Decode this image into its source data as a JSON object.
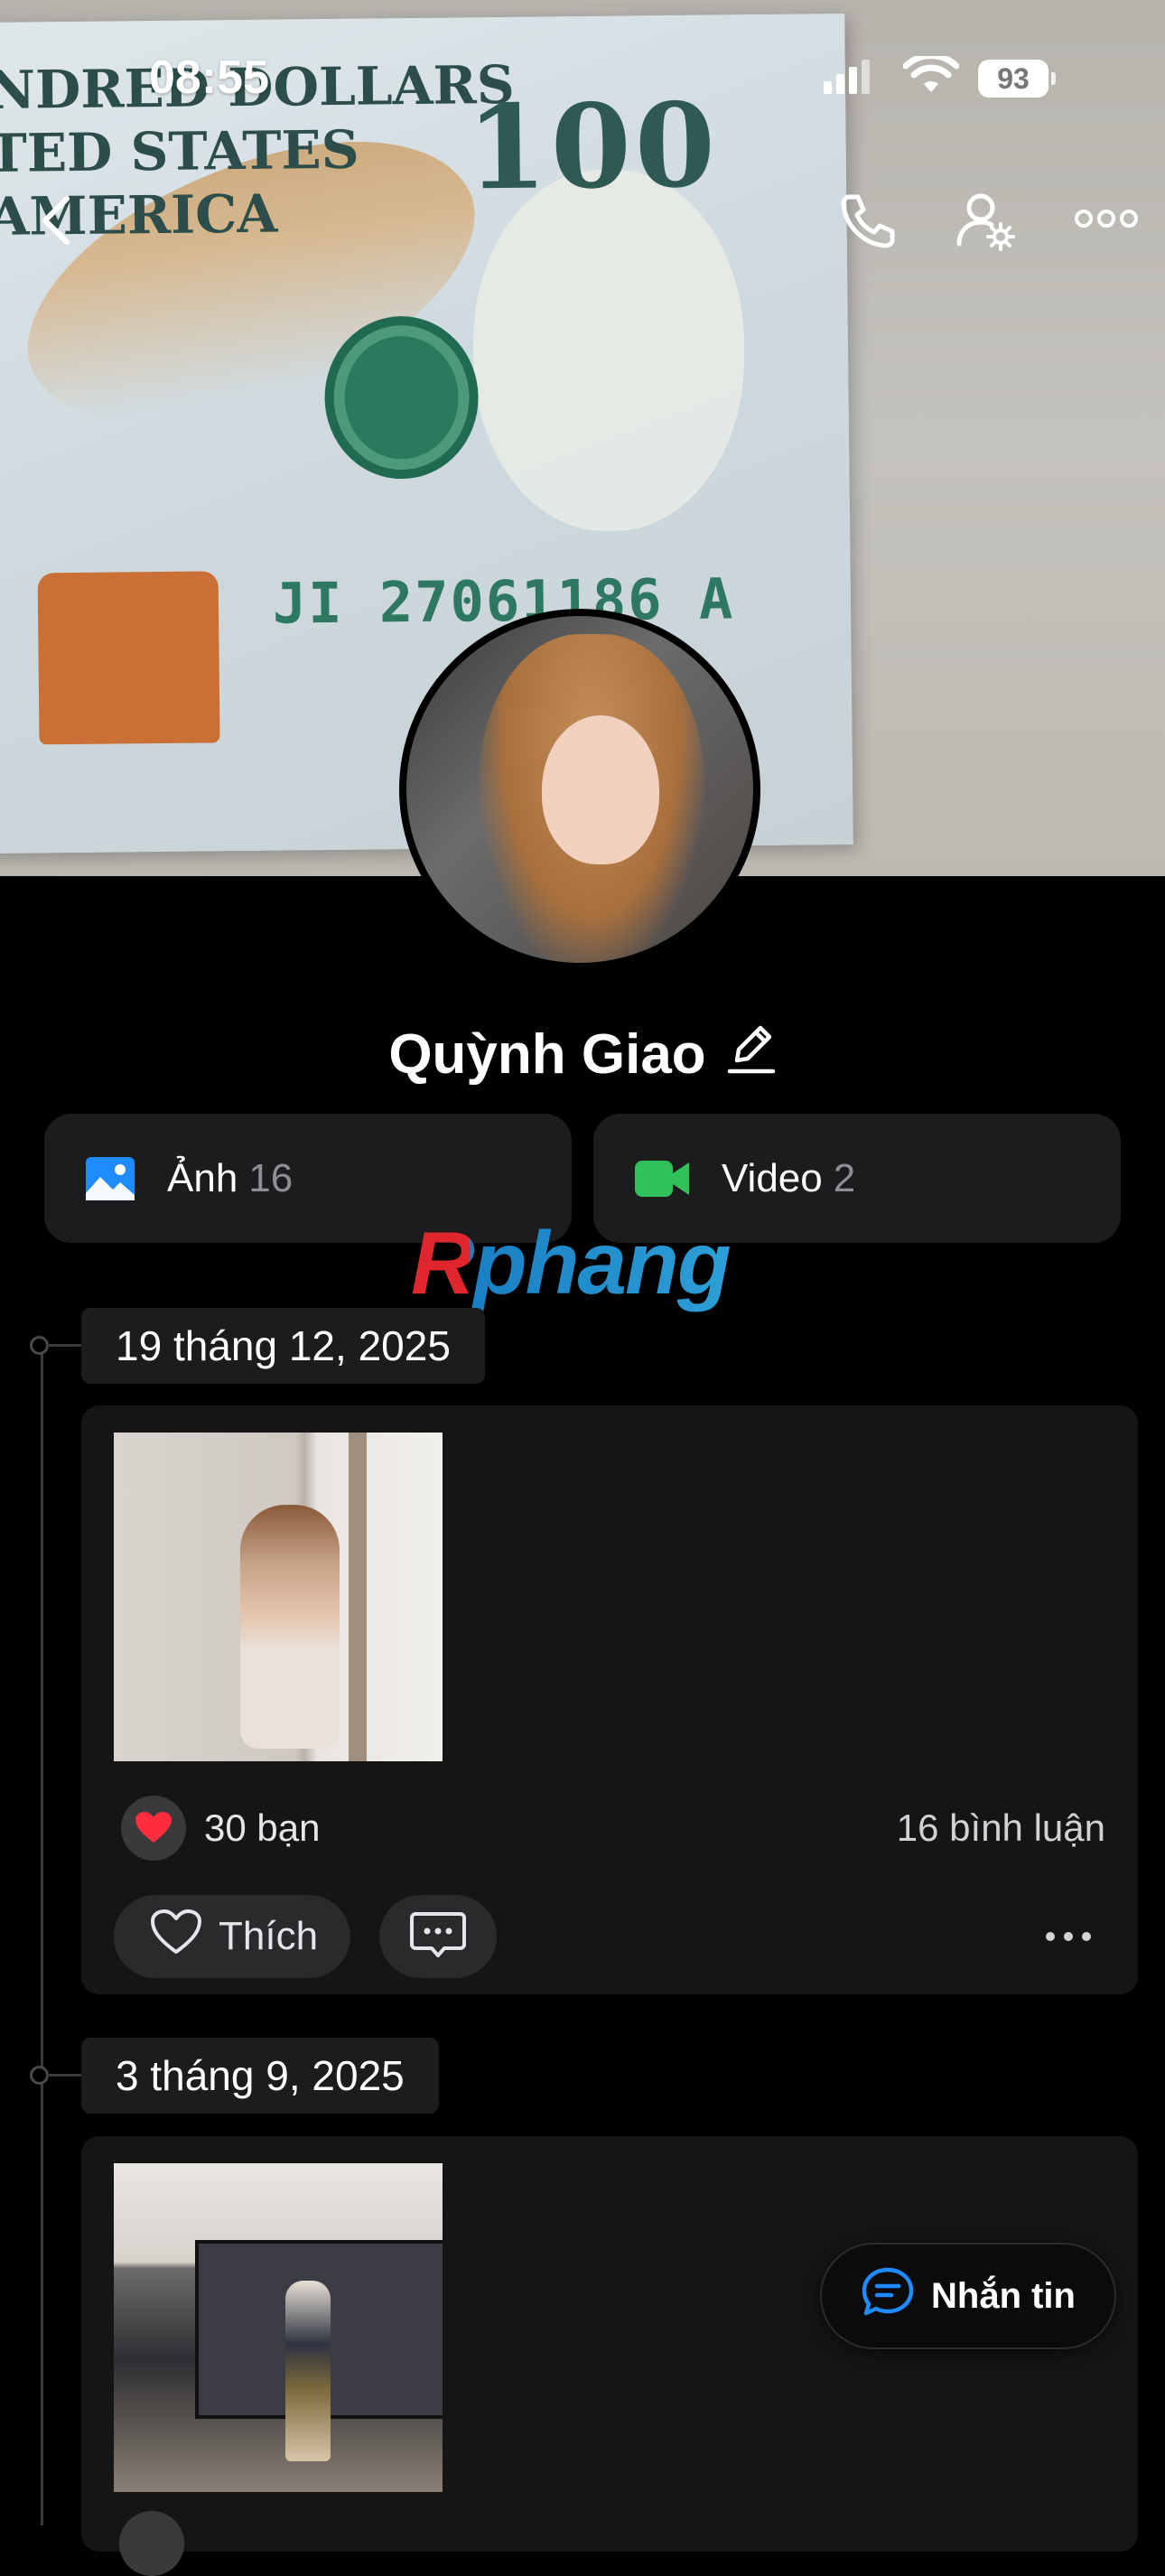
{
  "status_bar": {
    "time": "08:55",
    "battery": "93"
  },
  "top_nav": {
    "back_icon": "chevron-left-icon",
    "call_icon": "phone-icon",
    "settings_icon": "user-gear-icon",
    "more_icon": "more-horizontal-icon"
  },
  "profile": {
    "name": "Quỳnh Giao",
    "edit_icon": "pencil-icon"
  },
  "media_tabs": [
    {
      "label": "Ảnh",
      "count": "16",
      "icon": "image-icon",
      "color": "#1e8cff"
    },
    {
      "label": "Video",
      "count": "2",
      "icon": "video-camera-icon",
      "color": "#30c15b"
    }
  ],
  "watermark": "Rphang",
  "timeline": [
    {
      "date": "19 tháng 12, 2025",
      "reactions": "30 bạn",
      "comments": "16 bình luận",
      "like_label": "Thích"
    },
    {
      "date": "3 tháng 9, 2025"
    }
  ],
  "message_button": {
    "label": "Nhắn tin"
  },
  "colors": {
    "background": "#000000",
    "card": "#151516",
    "chip": "#1c1c1e",
    "accent_blue": "#1e8cff",
    "accent_green": "#30c15b",
    "heart_red": "#ff2d3d"
  }
}
